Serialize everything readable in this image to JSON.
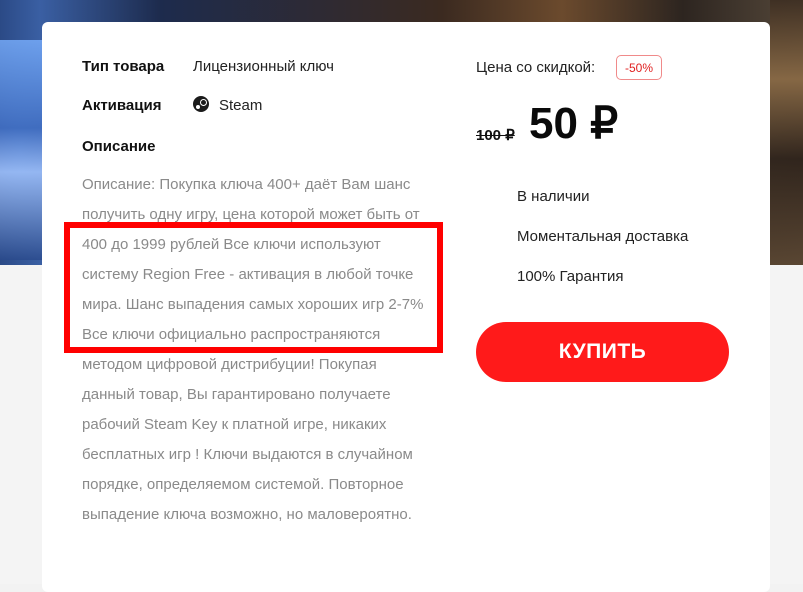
{
  "product": {
    "type_label": "Тип товара",
    "type_value": "Лицензионный ключ",
    "activation_label": "Активация",
    "activation_value": "Steam",
    "activation_icon": "steam-icon",
    "description_label": "Описание",
    "description_text": "Описание: Покупка ключа 400+ даёт Вам шанс получить одну игру, цена которой может быть от 400 до 1999 рублей Все ключи используют систему Region Free - активация в любой точке мира. Шанс выпадения самых хороших игр 2-7% Все ключи официально распространяются методом цифровой дистрибуции! Покупая данный товар, Вы гарантировано получаете рабочий Steam Key к платной игре, никаких бесплатных игр ! Ключи выдаются в случайном порядке, определяемом системой. Повторное выпадение ключа возможно, но маловероятно."
  },
  "pricing": {
    "discount_label": "Цена со скидкой:",
    "discount_badge": "-50%",
    "old_price": "100 ₽",
    "new_price": "50 ₽"
  },
  "features": [
    "В наличии",
    "Моментальная доставка",
    "100% Гарантия"
  ],
  "buy_button_label": "КУПИТЬ",
  "colors": {
    "accent": "#ff1a1a",
    "highlight_border": "#ff0000",
    "description_text": "#8a8a8a"
  }
}
